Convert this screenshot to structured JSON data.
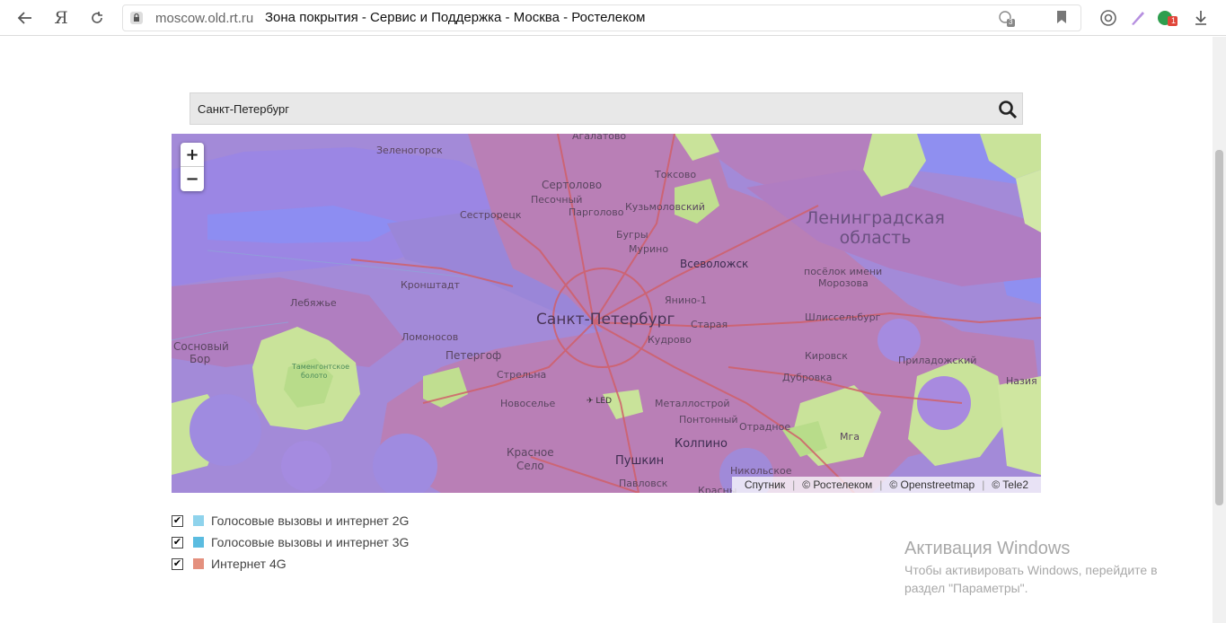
{
  "browser": {
    "url_domain": "moscow.old.rt.ru",
    "page_title": "Зона покрытия - Сервис и Поддержка - Москва - Ростелеком",
    "tab_count_badge": "3",
    "ext_badge": "1"
  },
  "search": {
    "value": "Санкт-Петербург"
  },
  "map": {
    "zoom_in": "+",
    "zoom_out": "−",
    "region_label": "Ленинградская область",
    "region_line1": "Ленинградская",
    "region_line2": "область",
    "city": "Санкт-Петербург",
    "towns": {
      "agalatovo": "Агалатово",
      "zelenogorsk": "Зеленогорск",
      "toksovo": "Токсово",
      "sertolovo": "Сертолово",
      "pesochny": "Песочный",
      "pargolovo": "Парголово",
      "kuzmolovsky": "Кузьмоловский",
      "sestroretsk": "Сестрорецк",
      "bugry": "Бугры",
      "murino": "Мурино",
      "vsevolozhsk": "Всеволожск",
      "morozova1": "посёлок имени",
      "morozova2": "Морозова",
      "kronshtadt": "Кронштадт",
      "yanino": "Янино-1",
      "lebyazhye": "Лебяжье",
      "staraya": "Старая",
      "shlisselburg": "Шлиссельбург",
      "kudrovo": "Кудрово",
      "sosnovy1": "Сосновый",
      "sosnovy2": "Бор",
      "lomonosov": "Ломоносов",
      "peterhof": "Петергоф",
      "kirovsk": "Кировск",
      "priladozhsky": "Приладожский",
      "strelna": "Стрельна",
      "dubrovka": "Дубровка",
      "nazia": "Назия",
      "novoselye": "Новоселье",
      "led": "LED",
      "metallostroy": "Металлострой",
      "pontonny": "Понтонный",
      "otradnoe": "Отрадное",
      "mga": "Мга",
      "kolpino": "Колпино",
      "krasnoe1": "Красное",
      "krasnoe2": "Село",
      "pushkin": "Пушкин",
      "nikolskoe": "Никольское",
      "pavlovsk": "Павловск",
      "krasny": "Красны",
      "tamengont1": "Таменгонтское",
      "tamengont2": "болото"
    },
    "attribution": [
      "Спутник",
      "© Ростелеком",
      "© Openstreetmap",
      "© Tele2"
    ],
    "colors": {
      "coverage_violet": "#a38ad8",
      "coverage_pink": "#b97fb6",
      "coverage_blue": "#8f8ff0",
      "land_green": "#c9e39a",
      "roads": "#d0606a"
    }
  },
  "legend": [
    {
      "label": "Голосовые вызовы и интернет 2G",
      "color": "#8fd3ec",
      "checked": true
    },
    {
      "label": "Голосовые вызовы и интернет 3G",
      "color": "#5bbce0",
      "checked": true
    },
    {
      "label": "Интернет 4G",
      "color": "#e4907e",
      "checked": true
    }
  ],
  "watermark": {
    "title": "Активация Windows",
    "text": "Чтобы активировать Windows, перейдите в раздел \"Параметры\"."
  }
}
